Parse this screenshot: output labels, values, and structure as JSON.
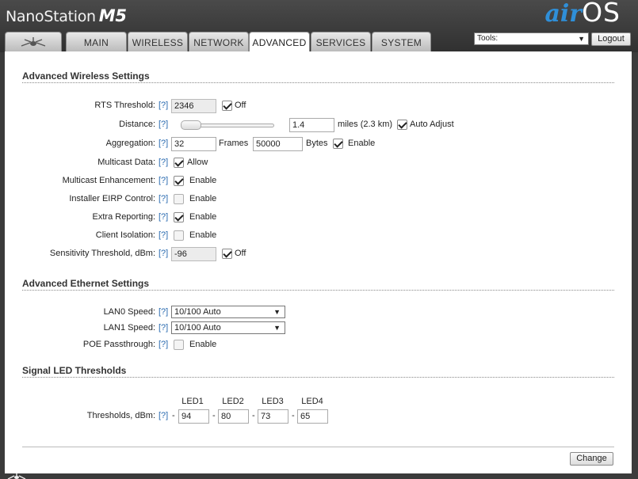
{
  "header": {
    "brand": "NanoStation",
    "model": "M5",
    "logo_air": "air",
    "logo_os": "OS"
  },
  "tabs": [
    {
      "label": "",
      "icon": "ubiquiti-logo-icon"
    },
    {
      "label": "MAIN"
    },
    {
      "label": "WIRELESS"
    },
    {
      "label": "NETWORK"
    },
    {
      "label": "ADVANCED",
      "active": true
    },
    {
      "label": "SERVICES"
    },
    {
      "label": "SYSTEM"
    }
  ],
  "tools": {
    "label": "Tools:"
  },
  "logout": "Logout",
  "help": "[?]",
  "wireless": {
    "title": "Advanced Wireless Settings",
    "rts": {
      "label": "RTS Threshold:",
      "value": "2346",
      "off_label": "Off",
      "off_checked": true
    },
    "distance": {
      "label": "Distance:",
      "value": "1.4",
      "unit": "miles (2.3 km)",
      "auto_label": "Auto Adjust",
      "auto_checked": true
    },
    "aggregation": {
      "label": "Aggregation:",
      "frames": "32",
      "frames_label": "Frames",
      "bytes": "50000",
      "bytes_label": "Bytes",
      "enable_label": "Enable",
      "enabled": true
    },
    "multicast_data": {
      "label": "Multicast Data:",
      "option": "Allow",
      "checked": true
    },
    "multicast_enh": {
      "label": "Multicast Enhancement:",
      "option": "Enable",
      "checked": true
    },
    "eirp": {
      "label": "Installer EIRP Control:",
      "option": "Enable",
      "checked": false
    },
    "extra": {
      "label": "Extra Reporting:",
      "option": "Enable",
      "checked": true
    },
    "isolation": {
      "label": "Client Isolation:",
      "option": "Enable",
      "checked": false
    },
    "sensitivity": {
      "label": "Sensitivity Threshold, dBm:",
      "value": "-96",
      "off_label": "Off",
      "off_checked": true
    }
  },
  "ethernet": {
    "title": "Advanced Ethernet Settings",
    "lan0": {
      "label": "LAN0 Speed:",
      "value": "10/100 Auto"
    },
    "lan1": {
      "label": "LAN1 Speed:",
      "value": "10/100 Auto"
    },
    "poe": {
      "label": "POE Passthrough:",
      "option": "Enable",
      "checked": false
    }
  },
  "led": {
    "title": "Signal LED Thresholds",
    "headers": [
      "LED1",
      "LED2",
      "LED3",
      "LED4"
    ],
    "label": "Thresholds, dBm:",
    "dash": "-",
    "values": [
      "94",
      "80",
      "73",
      "65"
    ]
  },
  "change": "Change"
}
